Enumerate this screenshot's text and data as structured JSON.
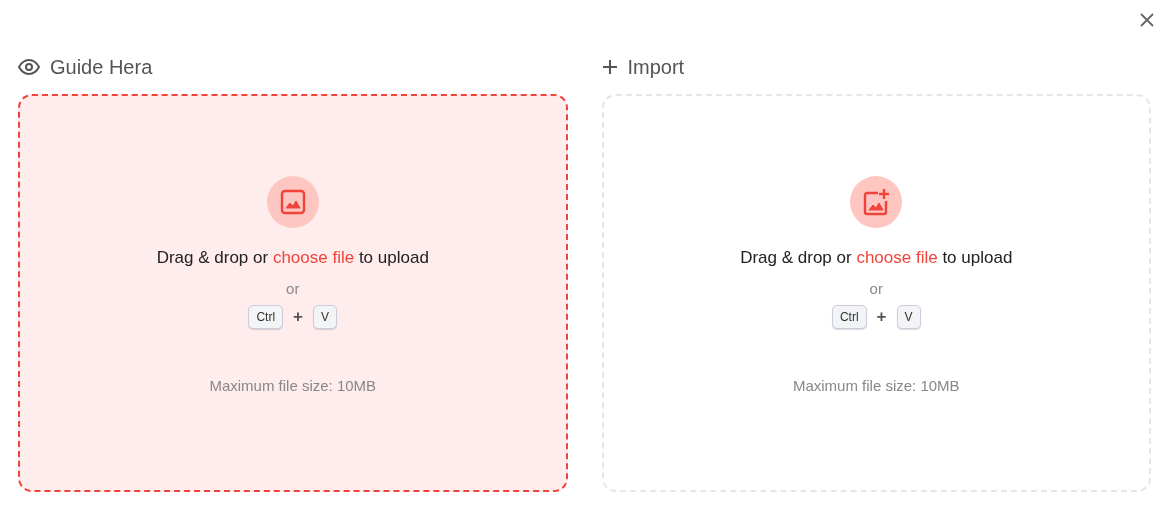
{
  "panels": [
    {
      "kind": "guide",
      "title": "Guide Hera",
      "active": true,
      "prompt": {
        "before": "Drag & drop or",
        "link": "choose file",
        "after": "to upload"
      },
      "or": "or",
      "keys": [
        "Ctrl",
        "+",
        "V"
      ],
      "limit": "Maximum file size: 10MB"
    },
    {
      "kind": "import",
      "title": "Import",
      "active": false,
      "prompt": {
        "before": "Drag & drop or",
        "link": "choose file",
        "after": "to upload"
      },
      "or": "or",
      "keys": [
        "Ctrl",
        "+",
        "V"
      ],
      "limit": "Maximum file size: 10MB"
    }
  ]
}
